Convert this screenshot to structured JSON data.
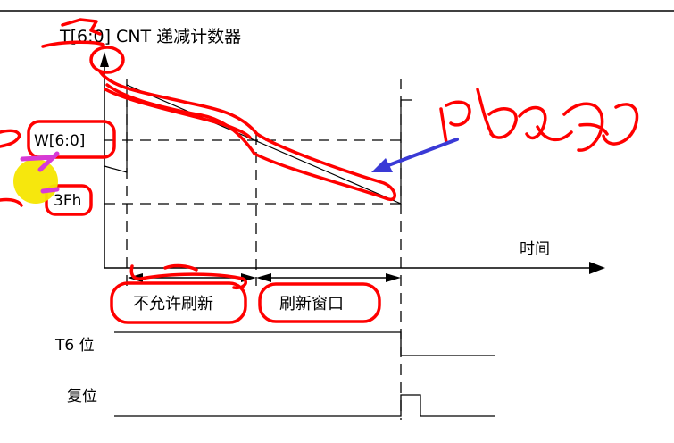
{
  "diagram": {
    "title": "T[6:0] CNT 递减计数器",
    "labels": {
      "w_label": "W[6:0]",
      "value_3fh": "3Fh",
      "time_axis": "时间",
      "no_refresh": "不允许刷新",
      "refresh_window": "刷新窗口",
      "t6_bit": "T6 位",
      "reset": "复位"
    },
    "annotations": {
      "handwritten_scribble": "handwritten-text-scribble"
    },
    "colors": {
      "line": "#000000",
      "annotation_red": "#ff0000",
      "annotation_blue": "#3a3ad6",
      "cursor_yellow": "#f5e600",
      "marker_magenta": "#d63ad6"
    }
  }
}
